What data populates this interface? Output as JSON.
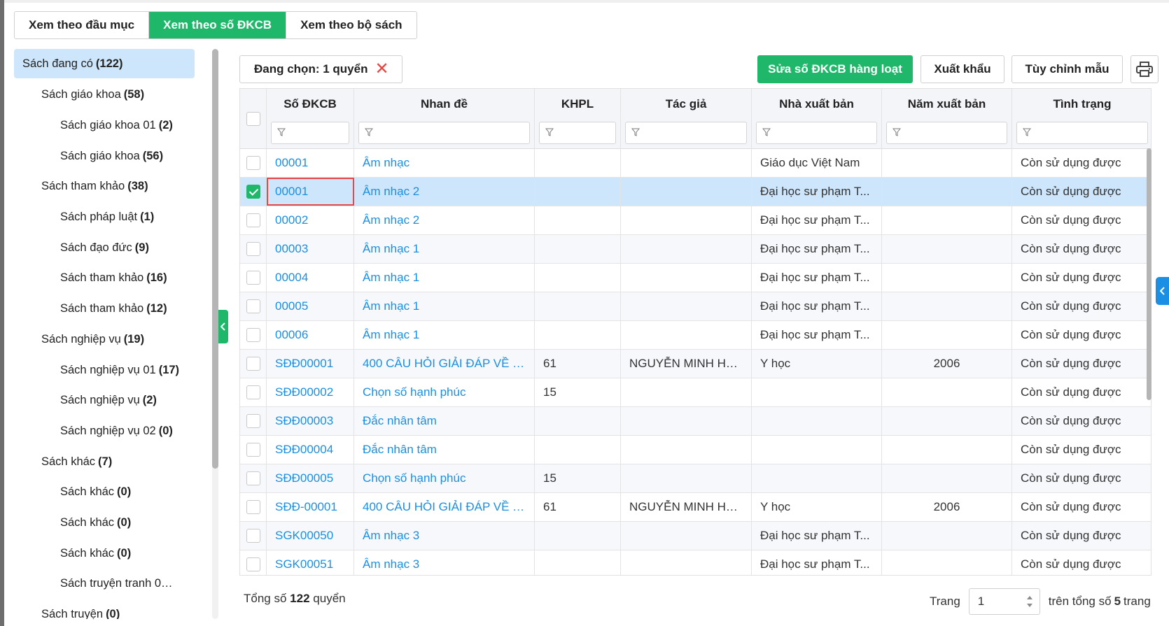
{
  "view_tabs": [
    {
      "label": "Xem theo đầu mục",
      "active": false
    },
    {
      "label": "Xem theo số ĐKCB",
      "active": true
    },
    {
      "label": "Xem theo bộ sách",
      "active": false
    }
  ],
  "sidebar": {
    "root": {
      "label": "Sách đang có",
      "count": "(122)"
    },
    "items": [
      {
        "label": "Sách giáo khoa",
        "count": "(58)",
        "level": 1
      },
      {
        "label": "Sách giáo khoa 01",
        "count": "(2)",
        "level": 2
      },
      {
        "label": "Sách giáo khoa",
        "count": "(56)",
        "level": 2
      },
      {
        "label": "Sách tham khảo",
        "count": "(38)",
        "level": 1
      },
      {
        "label": "Sách pháp luật",
        "count": "(1)",
        "level": 2
      },
      {
        "label": "Sách đạo đức",
        "count": "(9)",
        "level": 2
      },
      {
        "label": "Sách tham khảo",
        "count": "(16)",
        "level": 2
      },
      {
        "label": "Sách tham khảo",
        "count": "(12)",
        "level": 2
      },
      {
        "label": "Sách nghiệp vụ",
        "count": "(19)",
        "level": 1
      },
      {
        "label": "Sách nghiệp vụ 01",
        "count": "(17)",
        "level": 2
      },
      {
        "label": "Sách nghiệp vụ",
        "count": "(2)",
        "level": 2
      },
      {
        "label": "Sách nghiệp vụ 02",
        "count": "(0)",
        "level": 2
      },
      {
        "label": "Sách khác",
        "count": "(7)",
        "level": 1
      },
      {
        "label": "Sách khác",
        "count": "(0)",
        "level": 2
      },
      {
        "label": "Sách khác",
        "count": "(0)",
        "level": 2
      },
      {
        "label": "Sách khác",
        "count": "(0)",
        "level": 2
      },
      {
        "label": "Sách truyện tranh 02···",
        "count": "",
        "level": 2
      },
      {
        "label": "Sách truyện",
        "count": "(0)",
        "level": 1
      }
    ]
  },
  "toolbar": {
    "selected_label": "Đang chọn: 1 quyển",
    "bulk_edit_label": "Sửa số ĐKCB hàng loạt",
    "export_label": "Xuất khẩu",
    "template_label": "Tùy chỉnh mẫu"
  },
  "table": {
    "columns": [
      "Số ĐKCB",
      "Nhan đề",
      "KHPL",
      "Tác giả",
      "Nhà xuất bản",
      "Năm xuất bản",
      "Tình trạng"
    ],
    "rows": [
      {
        "checked": false,
        "code": "00001",
        "title": "Âm nhạc",
        "khpl": "",
        "author": "",
        "publisher": "Giáo dục Việt Nam",
        "year": "",
        "status": "Còn sử dụng được"
      },
      {
        "checked": true,
        "code": "00001",
        "title": "Âm nhạc 2",
        "khpl": "",
        "author": "",
        "publisher": "Đại học sư phạm T...",
        "year": "",
        "status": "Còn sử dụng được"
      },
      {
        "checked": false,
        "code": "00002",
        "title": "Âm nhạc 2",
        "khpl": "",
        "author": "",
        "publisher": "Đại học sư phạm T...",
        "year": "",
        "status": "Còn sử dụng được"
      },
      {
        "checked": false,
        "code": "00003",
        "title": "Âm nhạc 1",
        "khpl": "",
        "author": "",
        "publisher": "Đại học sư phạm T...",
        "year": "",
        "status": "Còn sử dụng được"
      },
      {
        "checked": false,
        "code": "00004",
        "title": "Âm nhạc 1",
        "khpl": "",
        "author": "",
        "publisher": "Đại học sư phạm T...",
        "year": "",
        "status": "Còn sử dụng được"
      },
      {
        "checked": false,
        "code": "00005",
        "title": "Âm nhạc 1",
        "khpl": "",
        "author": "",
        "publisher": "Đại học sư phạm T...",
        "year": "",
        "status": "Còn sử dụng được"
      },
      {
        "checked": false,
        "code": "00006",
        "title": "Âm nhạc 1",
        "khpl": "",
        "author": "",
        "publisher": "Đại học sư phạm T...",
        "year": "",
        "status": "Còn sử dụng được"
      },
      {
        "checked": false,
        "code": "SĐĐ00001",
        "title": "400 CÂU HỎI GIẢI ĐÁP VỀ S...",
        "khpl": "61",
        "author": "NGUYỄN MINH HỒ...",
        "publisher": "Y học",
        "year": "2006",
        "status": "Còn sử dụng được"
      },
      {
        "checked": false,
        "code": "SĐĐ00002",
        "title": "Chọn số hạnh phúc",
        "khpl": "15",
        "author": "",
        "publisher": "",
        "year": "",
        "status": "Còn sử dụng được"
      },
      {
        "checked": false,
        "code": "SĐĐ00003",
        "title": "Đắc nhân tâm",
        "khpl": "",
        "author": "",
        "publisher": "",
        "year": "",
        "status": "Còn sử dụng được"
      },
      {
        "checked": false,
        "code": "SĐĐ00004",
        "title": "Đắc nhân tâm",
        "khpl": "",
        "author": "",
        "publisher": "",
        "year": "",
        "status": "Còn sử dụng được"
      },
      {
        "checked": false,
        "code": "SĐĐ00005",
        "title": "Chọn số hạnh phúc",
        "khpl": "15",
        "author": "",
        "publisher": "",
        "year": "",
        "status": "Còn sử dụng được"
      },
      {
        "checked": false,
        "code": "SĐĐ-00001",
        "title": "400 CÂU HỎI GIẢI ĐÁP VỀ S...",
        "khpl": "61",
        "author": "NGUYỄN MINH HỒ...",
        "publisher": "Y học",
        "year": "2006",
        "status": "Còn sử dụng được"
      },
      {
        "checked": false,
        "code": "SGK00050",
        "title": "Âm nhạc 3",
        "khpl": "",
        "author": "",
        "publisher": "Đại học sư phạm T...",
        "year": "",
        "status": "Còn sử dụng được"
      },
      {
        "checked": false,
        "code": "SGK00051",
        "title": "Âm nhạc 3",
        "khpl": "",
        "author": "",
        "publisher": "Đại học sư phạm T...",
        "year": "",
        "status": "Còn sử dụng được"
      }
    ]
  },
  "footer": {
    "total_prefix": "Tổng số",
    "total_count": "122",
    "total_suffix": "quyển",
    "page_label": "Trang",
    "page_value": "1",
    "of_prefix": "trên tổng số",
    "page_count": "5",
    "of_suffix": "trang"
  },
  "icons": {
    "deselect": "close-icon",
    "print": "printer-icon",
    "filter": "funnel-icon",
    "collapse": "chevron-left-icon",
    "spinner": "up-down-spinner-icon"
  },
  "colors": {
    "accent_green": "#1fb86a",
    "link_blue": "#1a8fe3",
    "selected_row": "#cde6fb",
    "highlight_red": "#e54848"
  }
}
